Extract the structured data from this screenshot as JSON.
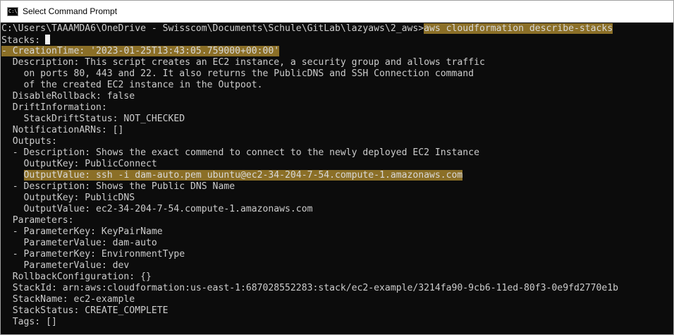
{
  "window": {
    "title": "Select Command Prompt",
    "icon_text": "C:\\",
    "colors": {
      "background": "#0c0c0c",
      "foreground": "#cccccc",
      "highlight": "#b08c30"
    }
  },
  "console": {
    "prompt": "C:\\Users\\TAAAMDA6\\OneDrive - Swisscom\\Documents\\Schule\\GitLab\\lazyaws\\2_aws>",
    "command": "aws cloudformation describe-stacks",
    "stacks_label": "Stacks:",
    "creation_dash": "- ",
    "creation_time": "CreationTime: '2023-01-25T13:43:05.759000+00:00'",
    "description_1": "  Description: This script creates an EC2 instance, a security group and allows traffic",
    "description_2": "    on ports 80, 443 and 22. It also returns the PublicDNS and SSH Connection command",
    "description_3": "    of the created EC2 instance in the Outpoot.",
    "disable_rollback": "  DisableRollback: false",
    "drift_information": "  DriftInformation:",
    "stack_drift_status": "    StackDriftStatus: NOT_CHECKED",
    "notification_arns": "  NotificationARNs: []",
    "outputs_label": "  Outputs:",
    "output1_description": "  - Description: Shows the exact commend to connect to the newly deployed EC2 Instance",
    "output1_key": "    OutputKey: PublicConnect",
    "output1_indent": "    ",
    "output1_value": "OutputValue: ssh -i dam-auto.pem ubuntu@ec2-34-204-7-54.compute-1.amazonaws.com",
    "output2_description": "  - Description: Shows the Public DNS Name",
    "output2_key": "    OutputKey: PublicDNS",
    "output2_value": "    OutputValue: ec2-34-204-7-54.compute-1.amazonaws.com",
    "parameters_label": "  Parameters:",
    "param1_key": "  - ParameterKey: KeyPairName",
    "param1_value": "    ParameterValue: dam-auto",
    "param2_key": "  - ParameterKey: EnvironmentType",
    "param2_value": "    ParameterValue: dev",
    "rollback_configuration": "  RollbackConfiguration: {}",
    "stack_id": "  StackId: arn:aws:cloudformation:us-east-1:687028552283:stack/ec2-example/3214fa90-9cb6-11ed-80f3-0e9fd2770e1b",
    "stack_name": "  StackName: ec2-example",
    "stack_status": "  StackStatus: CREATE_COMPLETE",
    "tags": "  Tags: []"
  }
}
